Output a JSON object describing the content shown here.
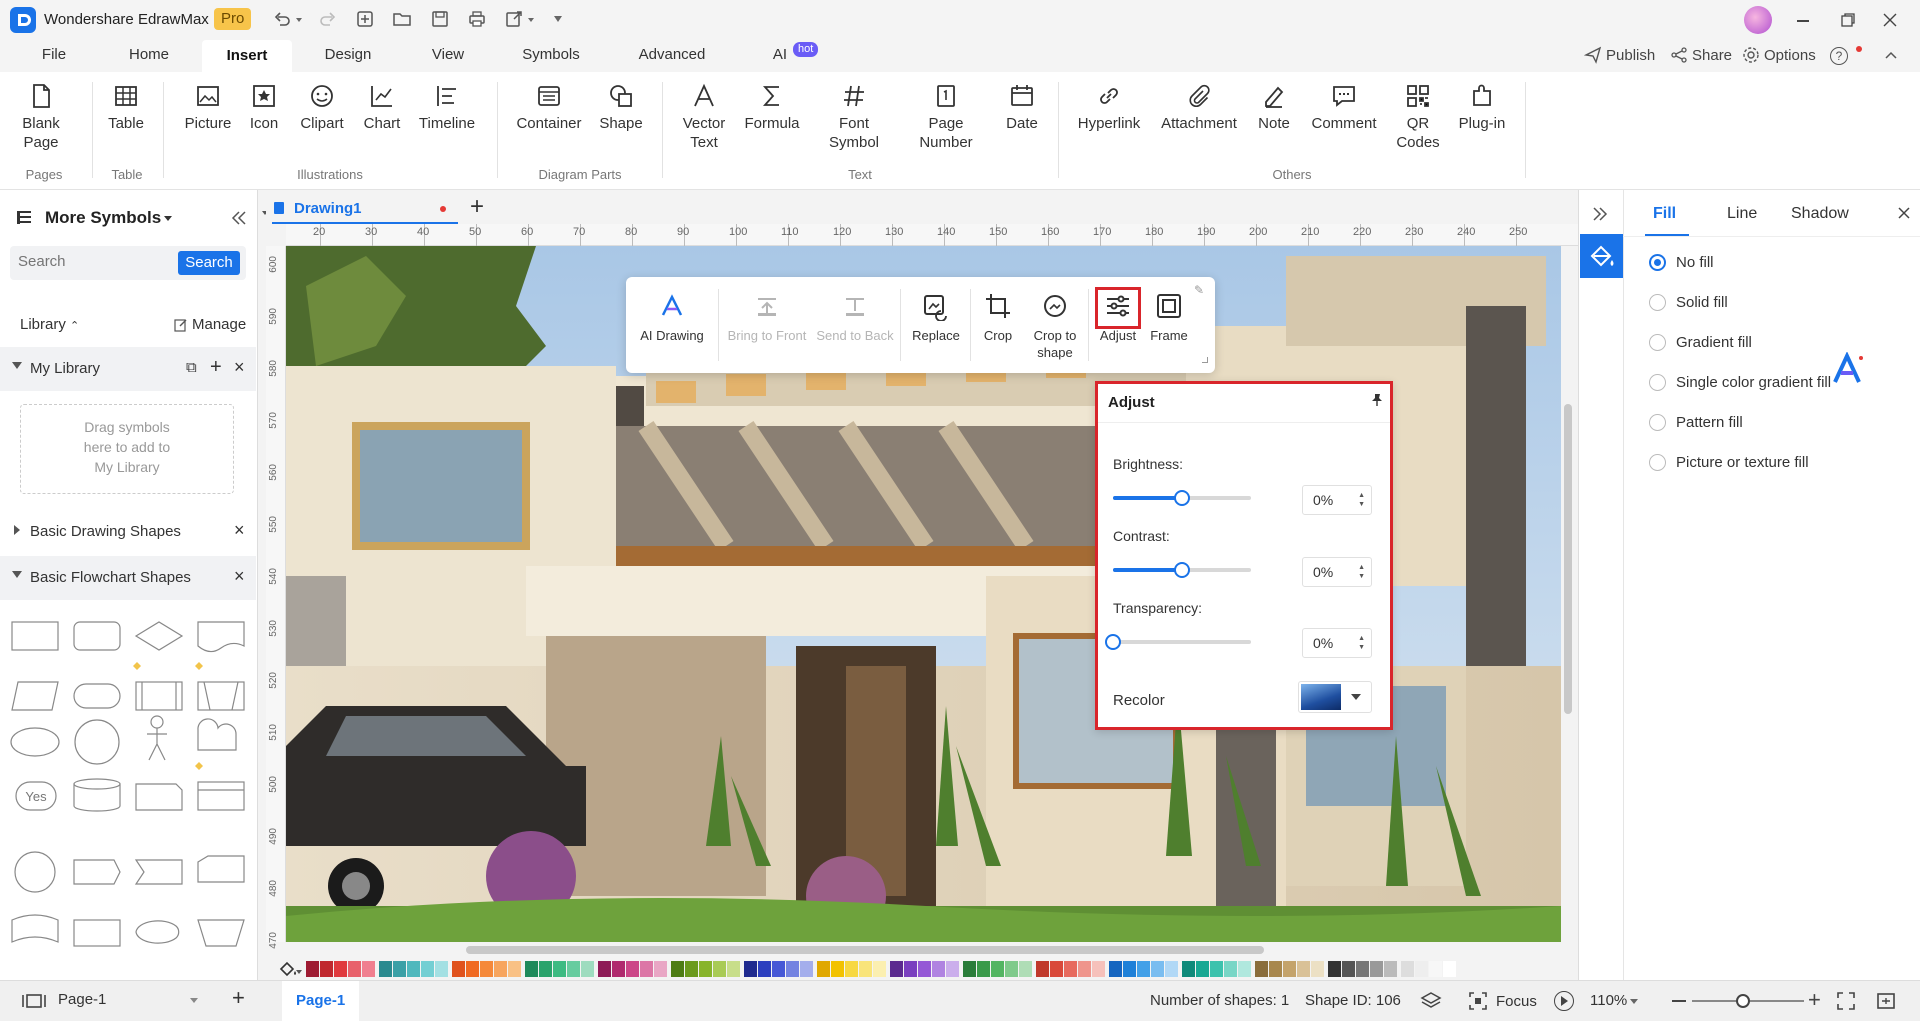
{
  "app": {
    "title": "Wondershare EdrawMax",
    "badge": "Pro"
  },
  "titlebar_right": {
    "publish": "Publish",
    "share": "Share",
    "options": "Options"
  },
  "menu": {
    "items": [
      "File",
      "Home",
      "Insert",
      "Design",
      "View",
      "Symbols",
      "Advanced",
      "AI"
    ],
    "ai_badge": "hot",
    "active": "Insert"
  },
  "ribbon": {
    "pages": {
      "blank_page": "Blank\nPage"
    },
    "table": {
      "table": "Table"
    },
    "illustrations": {
      "picture": "Picture",
      "icon": "Icon",
      "clipart": "Clipart",
      "chart": "Chart",
      "timeline": "Timeline"
    },
    "diagram_parts": {
      "container": "Container",
      "shape": "Shape"
    },
    "text": {
      "vector_text": "Vector\nText",
      "formula": "Formula",
      "font_symbol": "Font\nSymbol",
      "page_number": "Page\nNumber",
      "date": "Date"
    },
    "others": {
      "hyperlink": "Hyperlink",
      "attachment": "Attachment",
      "note": "Note",
      "comment": "Comment",
      "qr_codes": "QR\nCodes",
      "plugin": "Plug-in"
    },
    "groups": [
      "Pages",
      "Table",
      "Illustrations",
      "Diagram Parts",
      "Text",
      "Others"
    ]
  },
  "leftpanel": {
    "title": "More Symbols",
    "search_placeholder": "Search",
    "search_button": "Search",
    "library": "Library",
    "manage": "Manage",
    "my_library": "My Library",
    "drag_hint": "Drag symbols\nhere to add to\nMy Library",
    "basic_drawing": "Basic Drawing Shapes",
    "basic_flowchart": "Basic Flowchart Shapes",
    "yes_label": "Yes"
  },
  "document": {
    "tab": "Drawing1"
  },
  "ruler": {
    "h": [
      "20",
      "30",
      "40",
      "50",
      "60",
      "70",
      "80",
      "90",
      "100",
      "110",
      "120",
      "130",
      "140",
      "150",
      "160",
      "170",
      "180",
      "190",
      "200",
      "210",
      "220",
      "230",
      "240",
      "250"
    ],
    "v": [
      "600",
      "590",
      "580",
      "570",
      "560",
      "550",
      "540",
      "530",
      "520",
      "510",
      "500",
      "490",
      "480",
      "470"
    ]
  },
  "floatbar": {
    "ai_drawing": "AI Drawing",
    "bring_front": "Bring to Front",
    "send_back": "Send to Back",
    "replace": "Replace",
    "crop": "Crop",
    "crop_shape": "Crop to\nshape",
    "adjust": "Adjust",
    "frame": "Frame"
  },
  "adjust": {
    "title": "Adjust",
    "brightness": {
      "label": "Brightness:",
      "value": "0%",
      "level": 0.5
    },
    "contrast": {
      "label": "Contrast:",
      "value": "0%",
      "level": 0.5
    },
    "transparency": {
      "label": "Transparency:",
      "value": "0%",
      "level": 0.0
    },
    "recolor": "Recolor"
  },
  "rightpanel": {
    "tabs": [
      "Fill",
      "Line",
      "Shadow"
    ],
    "active_tab": "Fill",
    "options": [
      "No fill",
      "Solid fill",
      "Gradient fill",
      "Single color gradient fill",
      "Pattern fill",
      "Picture or texture fill"
    ],
    "selected": "No fill"
  },
  "status": {
    "page": "Page-1",
    "page_tab": "Page-1",
    "shapes": "Number of shapes: 1",
    "shape_id": "Shape ID: 106",
    "focus": "Focus",
    "zoom": "110%"
  },
  "colors": {
    "accent": "#1a73e8",
    "highlight": "#d9252b",
    "palette": [
      "#9e1b32",
      "#c0282e",
      "#e03a3e",
      "#e8616b",
      "#f07f8f",
      "#2a8a8f",
      "#3aa0a6",
      "#4fb8bd",
      "#74cfd3",
      "#a3e0e3",
      "#e0531e",
      "#f06a23",
      "#f5893a",
      "#f7a55e",
      "#f9c185",
      "#1f8a5b",
      "#2aa36c",
      "#3dbb82",
      "#67cc9f",
      "#9edcbf",
      "#8e1b57",
      "#b02a6e",
      "#cc4688",
      "#dc76a6",
      "#e9a6c5",
      "#4e7d14",
      "#6b9a1d",
      "#88b42b",
      "#a9cb55",
      "#c8de8a",
      "#1f2a8f",
      "#2c3fbf",
      "#4658d6",
      "#7483e1",
      "#a4aeec",
      "#e0a800",
      "#f2c200",
      "#f7d840",
      "#f9e47a",
      "#fbefb0",
      "#5b2a8f",
      "#7a3fbf",
      "#9558d6",
      "#b083e1",
      "#cbaeec",
      "#2a7d3a",
      "#3a9a4a",
      "#53b562",
      "#7fca8b",
      "#afddb6",
      "#c0392b",
      "#d9493a",
      "#e76a5e",
      "#ef958c",
      "#f6c1bb",
      "#1565c0",
      "#1e80d8",
      "#42a0e8",
      "#7abdf0",
      "#b1d8f6",
      "#0f8a7a",
      "#18a893",
      "#3cc2ad",
      "#78d6c6",
      "#b0e8de",
      "#8a6d3b",
      "#a8874d",
      "#c4a36b",
      "#d9c197",
      "#ece0c4",
      "#333333",
      "#555555",
      "#777777",
      "#999999",
      "#bbbbbb",
      "#dddddd",
      "#eeeeee",
      "#f7f7f7",
      "#ffffff"
    ]
  }
}
